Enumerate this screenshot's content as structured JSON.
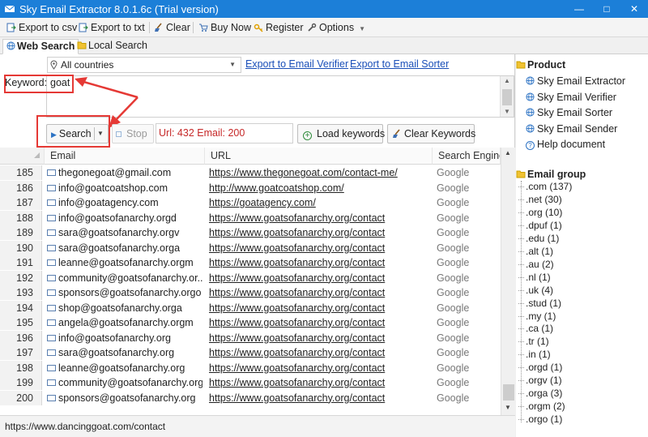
{
  "window": {
    "title": "Sky Email Extractor 8.0.1.6c (Trial version)"
  },
  "toolbar": {
    "export_csv": "Export to csv",
    "export_txt": "Export to txt",
    "clear": "Clear",
    "buy_now": "Buy Now",
    "register": "Register",
    "options": "Options"
  },
  "tabs": [
    {
      "label": "Web Search"
    },
    {
      "label": "Local Search"
    }
  ],
  "search": {
    "country": "All countries",
    "export_verifier": "Export to Email Verifier",
    "export_sorter": "Export to Email Sorter",
    "keyword_label": "Keyword:",
    "keyword_value": "goat",
    "search_btn": "Search",
    "stop_btn": "Stop",
    "stats": "Url: 432 Email: 200",
    "load_keywords": "Load keywords",
    "clear_keywords": "Clear Keywords"
  },
  "grid": {
    "headers": {
      "email": "Email",
      "url": "URL",
      "engine": "Search Engine"
    },
    "rows": [
      {
        "n": "185",
        "email": "thegonegoat@gmail.com",
        "url": "https://www.thegonegoat.com/contact-me/",
        "engine": "Google"
      },
      {
        "n": "186",
        "email": "info@goatcoatshop.com",
        "url": "http://www.goatcoatshop.com/",
        "engine": "Google"
      },
      {
        "n": "187",
        "email": "info@goatagency.com",
        "url": "https://goatagency.com/",
        "engine": "Google"
      },
      {
        "n": "188",
        "email": "info@goatsofanarchy.orgd",
        "url": "https://www.goatsofanarchy.org/contact",
        "engine": "Google"
      },
      {
        "n": "189",
        "email": "sara@goatsofanarchy.orgv",
        "url": "https://www.goatsofanarchy.org/contact",
        "engine": "Google"
      },
      {
        "n": "190",
        "email": "sara@goatsofanarchy.orga",
        "url": "https://www.goatsofanarchy.org/contact",
        "engine": "Google"
      },
      {
        "n": "191",
        "email": "leanne@goatsofanarchy.orgm",
        "url": "https://www.goatsofanarchy.org/contact",
        "engine": "Google"
      },
      {
        "n": "192",
        "email": "community@goatsofanarchy.or...",
        "url": "https://www.goatsofanarchy.org/contact",
        "engine": "Google"
      },
      {
        "n": "193",
        "email": "sponsors@goatsofanarchy.orgo",
        "url": "https://www.goatsofanarchy.org/contact",
        "engine": "Google"
      },
      {
        "n": "194",
        "email": "shop@goatsofanarchy.orga",
        "url": "https://www.goatsofanarchy.org/contact",
        "engine": "Google"
      },
      {
        "n": "195",
        "email": "angela@goatsofanarchy.orgm",
        "url": "https://www.goatsofanarchy.org/contact",
        "engine": "Google"
      },
      {
        "n": "196",
        "email": "info@goatsofanarchy.org",
        "url": "https://www.goatsofanarchy.org/contact",
        "engine": "Google"
      },
      {
        "n": "197",
        "email": "sara@goatsofanarchy.org",
        "url": "https://www.goatsofanarchy.org/contact",
        "engine": "Google"
      },
      {
        "n": "198",
        "email": "leanne@goatsofanarchy.org",
        "url": "https://www.goatsofanarchy.org/contact",
        "engine": "Google"
      },
      {
        "n": "199",
        "email": "community@goatsofanarchy.org",
        "url": "https://www.goatsofanarchy.org/contact",
        "engine": "Google"
      },
      {
        "n": "200",
        "email": "sponsors@goatsofanarchy.org",
        "url": "https://www.goatsofanarchy.org/contact",
        "engine": "Google"
      }
    ]
  },
  "status": {
    "text": "https://www.dancinggoat.com/contact"
  },
  "sidebar": {
    "product_title": "Product",
    "products": [
      "Sky Email Extractor",
      "Sky Email Verifier",
      "Sky Email Sorter",
      "Sky Email Sender",
      "Help document"
    ],
    "group_title": "Email group",
    "groups": [
      ".com (137)",
      ".net (30)",
      ".org (10)",
      ".dpuf (1)",
      ".edu (1)",
      ".alt (1)",
      ".au (2)",
      ".nl (1)",
      ".uk (4)",
      ".stud (1)",
      ".my (1)",
      ".ca (1)",
      ".tr (1)",
      ".in (1)",
      ".orgd (1)",
      ".orgv (1)",
      ".orga (3)",
      ".orgm (2)",
      ".orgo (1)"
    ]
  },
  "colors": {
    "titlebar": "#1c7fd8",
    "annotation": "#e53935",
    "link": "#1a4fb8"
  }
}
